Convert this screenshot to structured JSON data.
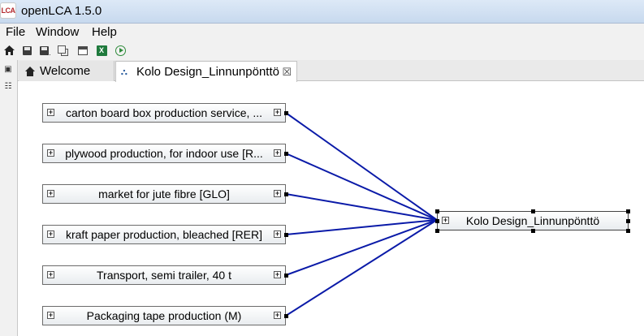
{
  "app": {
    "logo_text": "LCA",
    "title": "openLCA 1.5.0"
  },
  "menu": {
    "items": [
      "File",
      "Window",
      "Help"
    ]
  },
  "toolbar": {
    "icons": [
      "home-icon",
      "save-icon",
      "save-as-icon",
      "save-all-icon",
      "window-icon",
      "excel-icon",
      "run-icon"
    ],
    "excel_glyph": "X"
  },
  "tabs": [
    {
      "label": "Welcome",
      "icon": "home-icon",
      "active": false
    },
    {
      "label": "Kolo Design_Linnunpönttö",
      "icon": "model-graph-icon",
      "active": true,
      "close": "☒"
    }
  ],
  "graph": {
    "expander_glyph": "+",
    "input_processes": [
      "carton board box production service, ...",
      "plywood production, for indoor use [R...",
      "market for jute fibre [GLO]",
      "kraft paper production, bleached [RER]",
      "Transport, semi trailer, 40 t",
      "Packaging tape production (M)"
    ],
    "reference_process": "Kolo Design_Linnunpönttö",
    "link_color": "#0a1aa8"
  }
}
